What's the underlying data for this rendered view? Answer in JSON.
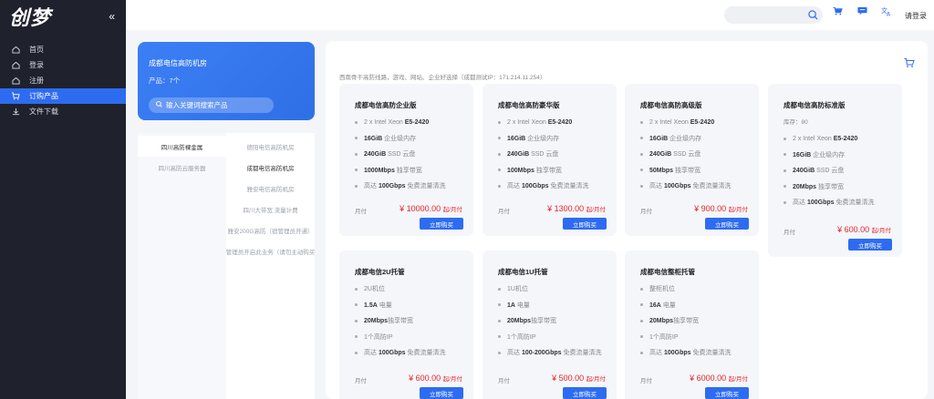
{
  "sidebar": {
    "logo": "创梦",
    "collapse": "«",
    "items": [
      {
        "label": "首页",
        "icon": "home-icon"
      },
      {
        "label": "登录",
        "icon": "login-icon"
      },
      {
        "label": "注册",
        "icon": "register-icon"
      },
      {
        "label": "订购产品",
        "icon": "cart-icon",
        "active": true
      },
      {
        "label": "文件下载",
        "icon": "download-icon"
      }
    ]
  },
  "header": {
    "search_placeholder": "",
    "login": "请登录"
  },
  "hero": {
    "title": "成都电信高防机房",
    "count": "产品：7个",
    "search_placeholder": "输入关键词搜索产品"
  },
  "categories": {
    "left": [
      "四川高防裸金属",
      "四川高防云服务器"
    ],
    "right": [
      "德阳电信高防机房",
      "成都电信高防机房",
      "雅安电信高防机房",
      "四川大带宽 流量计费",
      "雅安200G高防（宿管理员开通）",
      "管理员开启此业务（请勿主动购买"
    ]
  },
  "main": {
    "desc": "西南骨干高防线路，游戏、网站、企业好选择（成都测试IP：171.214.11.254）"
  },
  "cards": [
    {
      "title": "成都电信高防企业版",
      "stock": "",
      "specs": [
        [
          "2 x Intel Xeon ",
          "E5-2420"
        ],
        [
          "16GiB",
          " 企业级内存"
        ],
        [
          "240GiB",
          " SSD 云盘"
        ],
        [
          "1000Mbps",
          " 独享带宽"
        ],
        [
          "高达 ",
          "100Gbps",
          " 免费流量清洗"
        ]
      ],
      "cycle": "月付",
      "price": "¥ 10000.00",
      "unit": "起/月付",
      "buy": "立即购买"
    },
    {
      "title": "成都电信高防豪华版",
      "stock": "",
      "specs": [
        [
          "2 x Intel Xeon ",
          "E5-2420"
        ],
        [
          "16GiB",
          " 企业级内存"
        ],
        [
          "240GiB",
          " SSD 云盘"
        ],
        [
          "100Mbps",
          " 独享带宽"
        ],
        [
          "高达 ",
          "100Gbps",
          " 免费流量清洗"
        ]
      ],
      "cycle": "月付",
      "price": "¥ 1300.00",
      "unit": "起/月付",
      "buy": "立即购买"
    },
    {
      "title": "成都电信高防高级版",
      "stock": "",
      "specs": [
        [
          "2 x Intel Xeon ",
          "E5-2420"
        ],
        [
          "16GiB",
          " 企业级内存"
        ],
        [
          "240GiB",
          " SSD 云盘"
        ],
        [
          "50Mbps",
          " 独享带宽"
        ],
        [
          "高达 ",
          "100Gbps",
          " 免费流量清洗"
        ]
      ],
      "cycle": "月付",
      "price": "¥ 900.00",
      "unit": "起/月付",
      "buy": "立即购买"
    },
    {
      "title": "成都电信高防标准版",
      "stock": "库存：80",
      "specs": [
        [
          "2 x Intel Xeon ",
          "E5-2420"
        ],
        [
          "16GiB",
          " 企业级内存"
        ],
        [
          "240GiB",
          " SSD 云盘"
        ],
        [
          "20Mbps",
          " 独享带宽"
        ],
        [
          "高达 ",
          "100Gbps",
          " 免费流量清洗"
        ]
      ],
      "cycle": "月付",
      "price": "¥ 600.00",
      "unit": "起/月付",
      "buy": "立即购买"
    },
    {
      "title": "成都电信2U托管",
      "stock": "",
      "specs": [
        [
          "2U机位"
        ],
        [
          "1.5A",
          " 电量"
        ],
        [
          "20Mbps",
          "独享带宽"
        ],
        [
          "1个高防IP"
        ],
        [
          "高达 ",
          "100Gbps",
          " 免费流量清洗"
        ]
      ],
      "cycle": "月付",
      "price": "¥ 600.00",
      "unit": "起/月付",
      "buy": "立即购买"
    },
    {
      "title": "成都电信1U托管",
      "stock": "",
      "specs": [
        [
          "1U机位"
        ],
        [
          "1A",
          " 电量"
        ],
        [
          "20Mbps",
          "独享带宽"
        ],
        [
          "1个高防IP"
        ],
        [
          "高达 ",
          "100-200Gbps",
          " 免费流量清洗"
        ]
      ],
      "cycle": "月付",
      "price": "¥ 500.00",
      "unit": "起/月付",
      "buy": "立即购买"
    },
    {
      "title": "成都电信整柜托管",
      "stock": "",
      "specs": [
        [
          "整柜机位"
        ],
        [
          "16A",
          " 电量"
        ],
        [
          "20Mbps",
          "独享带宽"
        ],
        [
          "1个高防IP"
        ],
        [
          "高达 ",
          "100Gbps",
          " 免费流量清洗"
        ]
      ],
      "cycle": "月付",
      "price": "¥ 6000.00",
      "unit": "起/月付",
      "buy": "立即购买"
    }
  ],
  "colors": {
    "accent": "#2d6cf0",
    "sidebar": "#1f222c",
    "price": "#e5262b"
  }
}
